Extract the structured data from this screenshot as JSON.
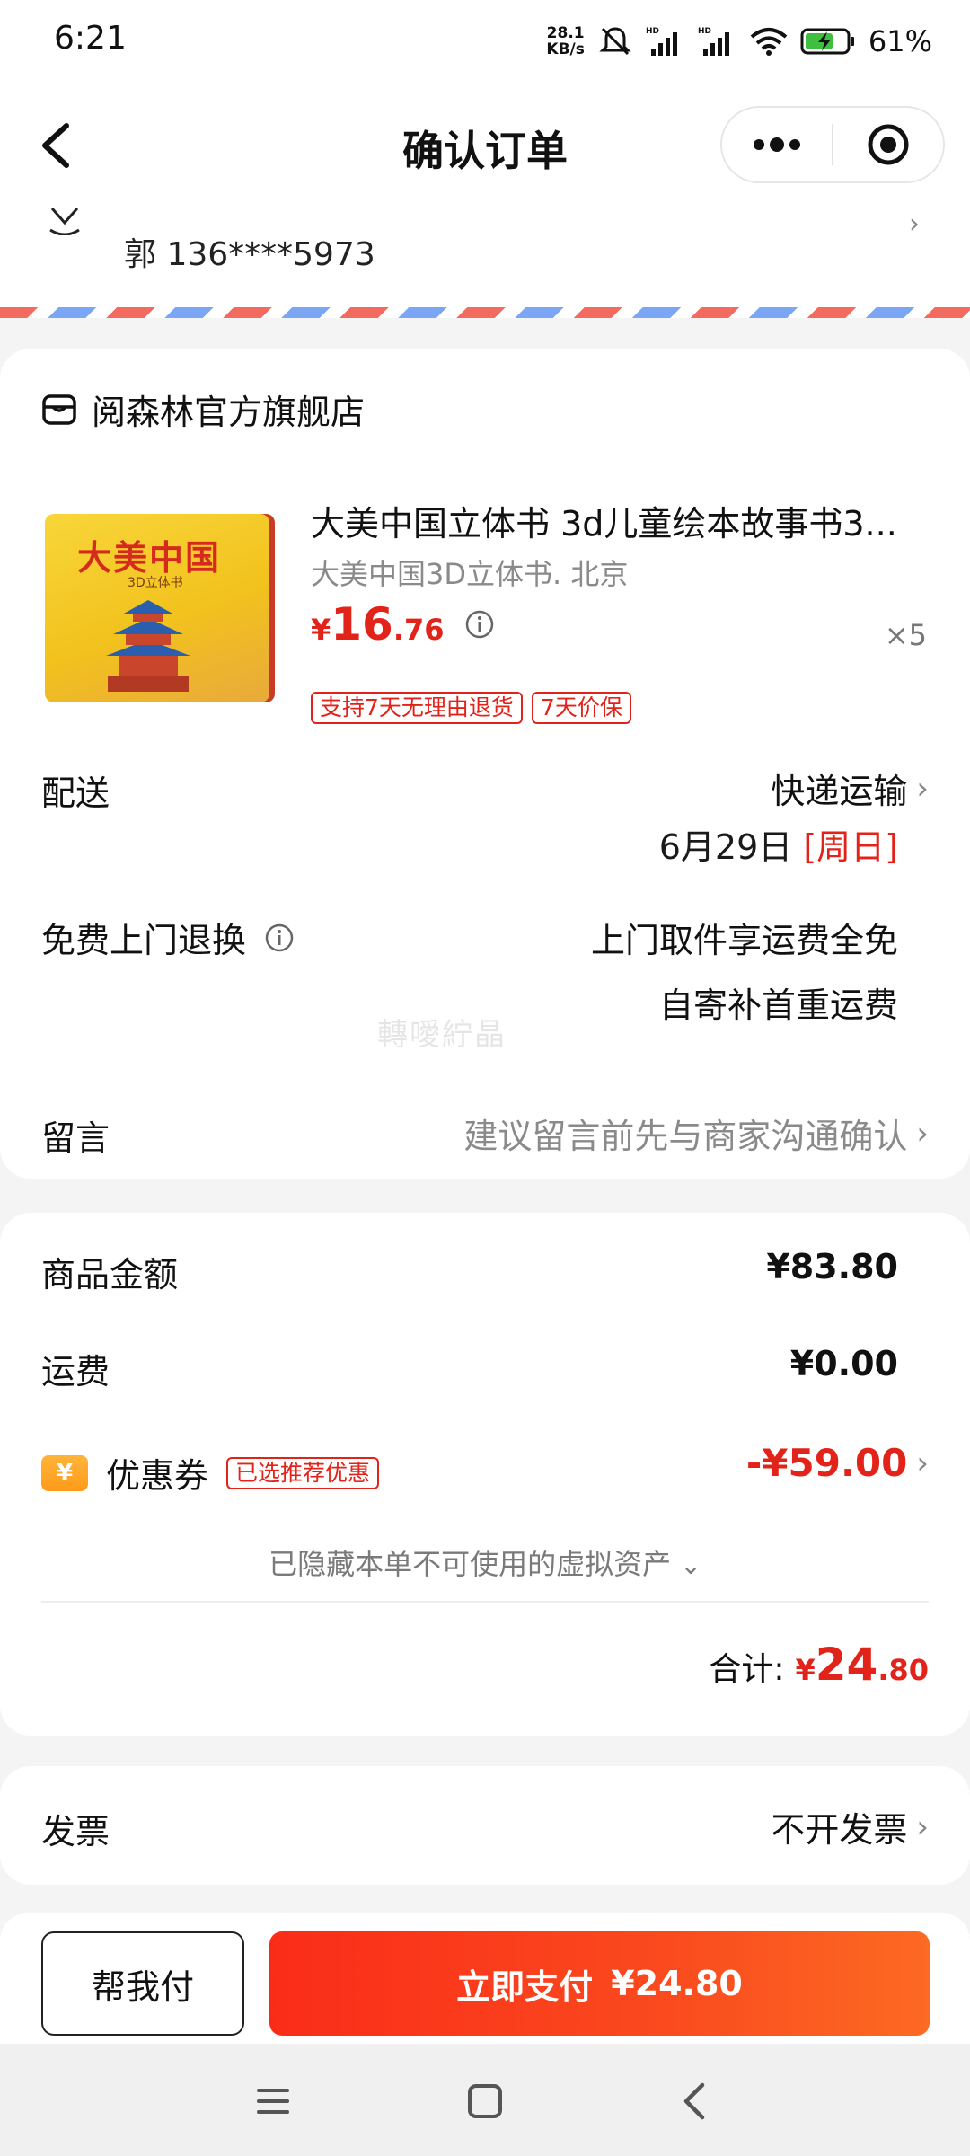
{
  "status_bar": {
    "time": "6:21",
    "net_speed_value": "28.1",
    "net_speed_unit": "KB/s",
    "battery_percent": "61%"
  },
  "header": {
    "title": "确认订单"
  },
  "address": {
    "contact": "郭 136****5973"
  },
  "store": {
    "name": "阅森林官方旗舰店"
  },
  "product": {
    "thumb_title": "大美中国",
    "thumb_sub": "3D立体书",
    "title": "大美中国立体书 3d儿童绘本故事书3...",
    "spec": "大美中国3D立体书. 北京",
    "price_symbol": "¥",
    "price_int": "16",
    "price_dec": ".76",
    "quantity": "×5",
    "tags": [
      "支持7天无理由退货",
      "7天价保"
    ]
  },
  "delivery": {
    "label": "配送",
    "method": "快递运输",
    "date": "6月29日",
    "weekday": "[周日]"
  },
  "return_service": {
    "label": "免费上门退换",
    "line1": "上门取件享运费全免",
    "line2": "自寄补首重运费"
  },
  "message": {
    "label": "留言",
    "placeholder": "建议留言前先与商家沟通确认"
  },
  "watermark": "轉噯紵晶",
  "summary": {
    "goods_label": "商品金额",
    "goods_value": "¥83.80",
    "shipping_label": "运费",
    "shipping_value": "¥0.00",
    "coupon_badge": "¥",
    "coupon_label": "优惠券",
    "coupon_tag": "已选推荐优惠",
    "coupon_value": "-¥59.00",
    "hidden_assets": "已隐藏本单不可使用的虚拟资产",
    "total_label": "合计:",
    "total_symbol": "¥",
    "total_int": "24",
    "total_dec": ".80"
  },
  "invoice": {
    "label": "发票",
    "value": "不开发票"
  },
  "actions": {
    "help_pay": "帮我付",
    "pay_label": "立即支付",
    "pay_amount": "¥24.80"
  },
  "colors": {
    "accent_red": "#e2231a",
    "pay_gradient_start": "#fa2c19",
    "pay_gradient_end": "#fc6a23"
  }
}
